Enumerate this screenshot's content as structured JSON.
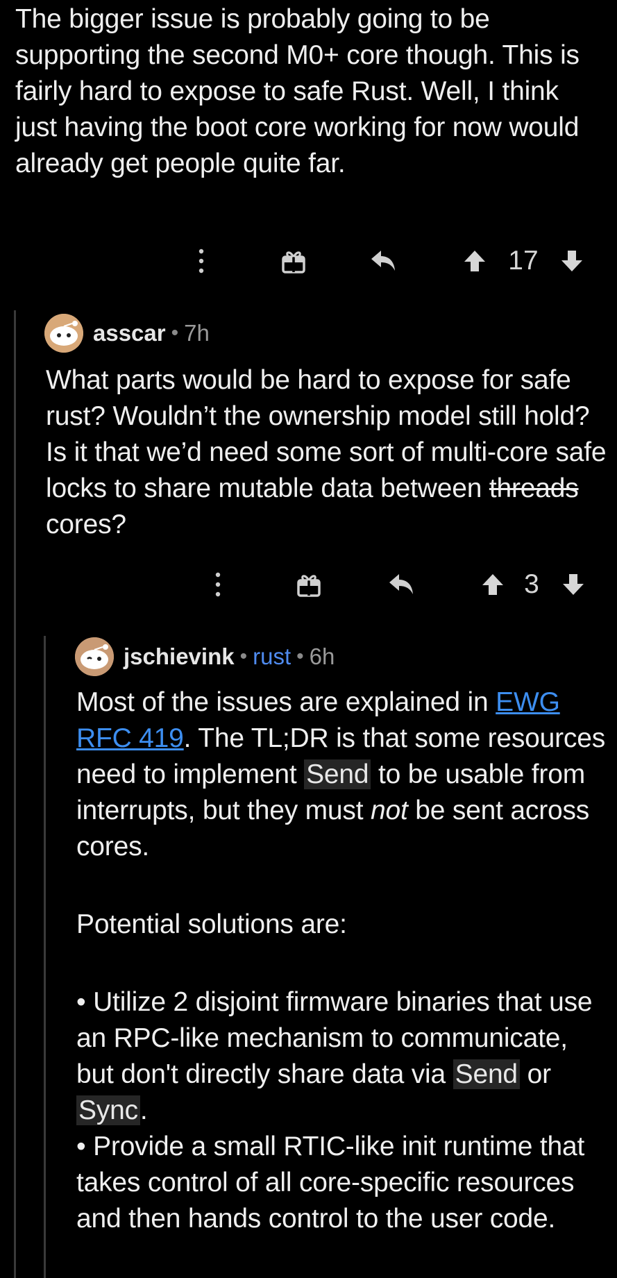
{
  "comment1": {
    "text": "The bigger issue is probably going to be supporting the second M0+ core though. This is fairly hard to expose to safe Rust. Well, I think just having the boot core working for now would already get people quite far.",
    "votes": "17"
  },
  "comment2": {
    "username": "asscar",
    "age": "7h",
    "text_before": "What parts would be hard to expose for safe rust? Wouldn’t the ownership model still hold? Is it that we’d need some sort of multi-core safe locks to share mutable data between",
    "struck": "threads",
    "text_after": "cores?",
    "votes": "3"
  },
  "comment3": {
    "username": "jschievink",
    "flair": "rust",
    "age": "6h",
    "p1_a": "Most of the issues are explained in",
    "link": "EWG RFC 419",
    "p1_b": ". The TL;DR is that some resources need to implement",
    "code_send": "Send",
    "p1_c": "to be usable from interrupts, but they must",
    "p1_em": "not",
    "p1_d": "be sent across cores.",
    "p2": "Potential solutions are:",
    "b1_a": "• Utilize 2 disjoint firmware binaries that use an RPC-like mechanism to communicate, but don't directly share data via",
    "b1_code1": "Send",
    "b1_or": "or",
    "b1_code2": "Sync",
    "b1_end": ".",
    "b2": "• Provide a small RTIC-like init runtime that takes control of all core-specific resources and then hands control to the user code."
  },
  "icons": [
    "more-icon",
    "gift-icon",
    "reply-icon",
    "upvote-icon",
    "downvote-icon"
  ],
  "colors": {
    "background": "#000000",
    "text": "#efefef",
    "link": "#3d8ef0",
    "flair": "#4f8bf0",
    "thread_line": "#3a3a3a"
  }
}
